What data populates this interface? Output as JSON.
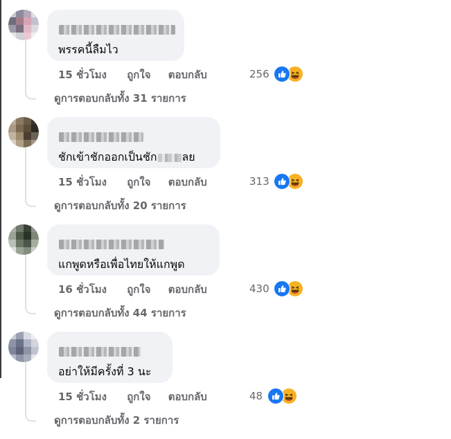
{
  "actions": {
    "like_label": "ถูกใจ",
    "reply_label": "ตอบกลับ"
  },
  "colors": {
    "like": "#1877f2",
    "haha": "#f7b125",
    "meta_text": "#65676b",
    "bubble_bg": "#f0f2f5"
  },
  "icons": [
    "like-icon",
    "haha-icon"
  ],
  "comments": [
    {
      "text": "พรรคนี้ลืมไว",
      "time": "15 ชั่วโมง",
      "reaction_count": "256",
      "replies": "ดูการตอบกลับทั้ง 31 รายการ"
    },
    {
      "text_before": "ชักเข้าชักออกเป็นชัก",
      "text_after": "ลย",
      "time": "15 ชั่วโมง",
      "reaction_count": "313",
      "replies": "ดูการตอบกลับทั้ง 20 รายการ"
    },
    {
      "text": "แกพูดหรือเพื่อไทยให้แกพูด",
      "time": "16 ชั่วโมง",
      "reaction_count": "430",
      "replies": "ดูการตอบกลับทั้ง 44 รายการ"
    },
    {
      "text": "อย่าให้มีครั้งที่ 3 นะ",
      "time": "15 ชั่วโมง",
      "reaction_count": "48",
      "replies": "ดูการตอบกลับทั้ง 2 รายการ"
    }
  ]
}
